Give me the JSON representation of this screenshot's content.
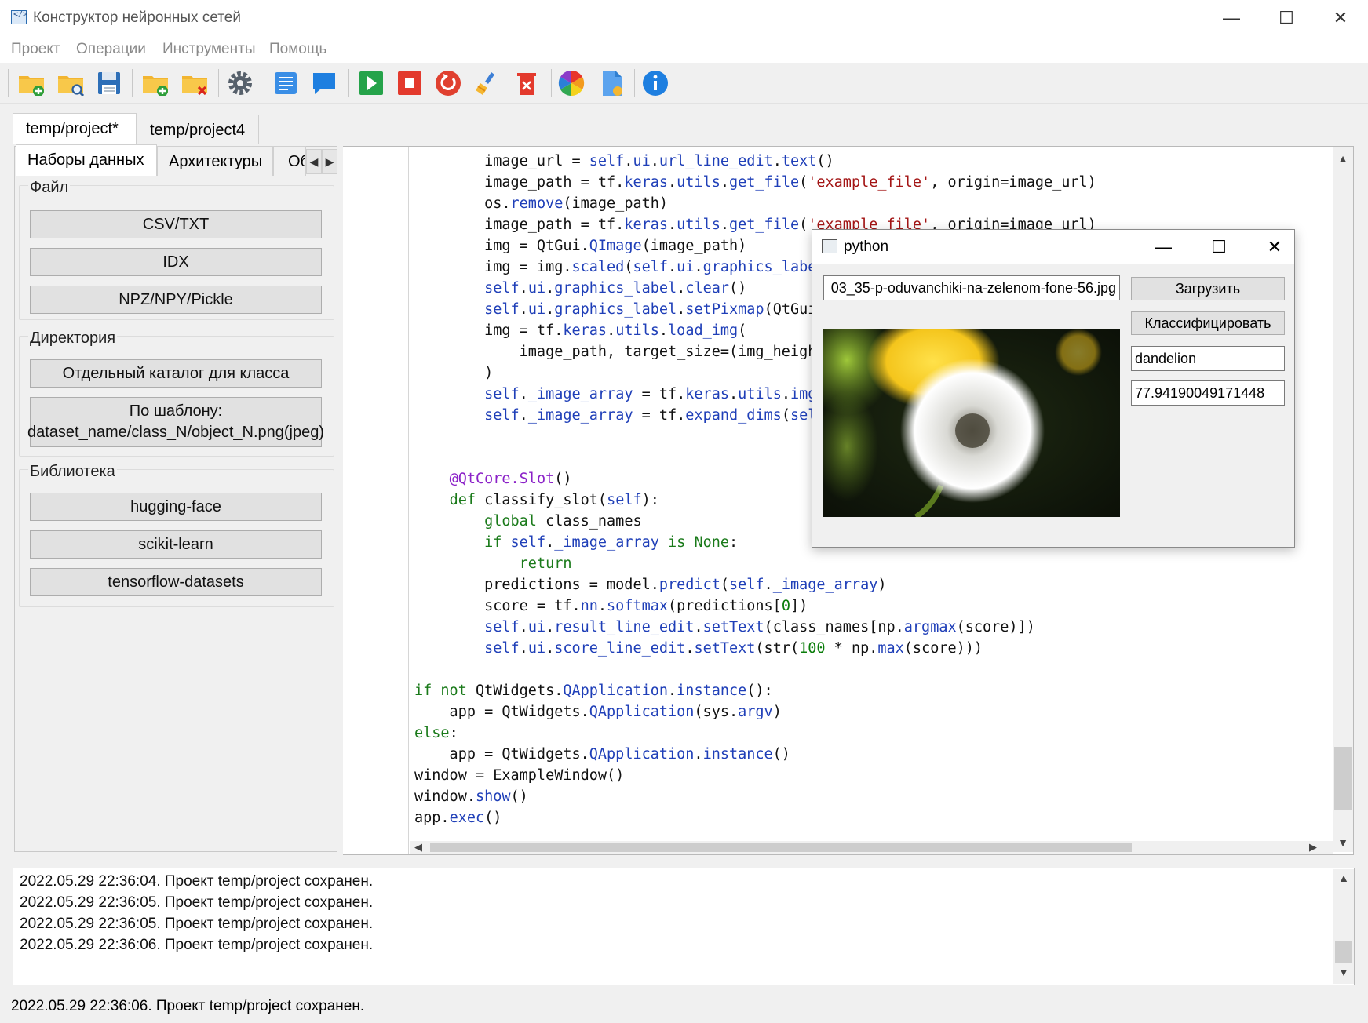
{
  "window": {
    "title": "Конструктор нейронных сетей",
    "minimize": "—",
    "maximize": "☐",
    "close": "✕"
  },
  "menu": [
    "Проект",
    "Операции",
    "Инструменты",
    "Помощь"
  ],
  "toolbar_icons": [
    "new-project-icon",
    "open-project-icon",
    "save-icon",
    "add-folder-icon",
    "remove-folder-icon",
    "settings-icon",
    "text-document-icon",
    "comment-icon",
    "run-icon",
    "stop-icon",
    "restart-icon",
    "clean-icon",
    "delete-icon",
    "color-palette-icon",
    "file-config-icon",
    "info-icon"
  ],
  "project_tabs": [
    "temp/project*",
    "temp/project4"
  ],
  "left_tabs": [
    "Наборы данных",
    "Архитектуры",
    "Об"
  ],
  "left_scroll": {
    "left": "◀",
    "right": "▶"
  },
  "sections": {
    "file": {
      "label": "Файл",
      "buttons": [
        "CSV/TXT",
        "IDX",
        "NPZ/NPY/Pickle"
      ]
    },
    "directory": {
      "label": "Директория",
      "buttons": [
        "Отдельный каталог для класса"
      ],
      "template_button": {
        "line1": "По шаблону:",
        "line2": "dataset_name/class_N/object_N.png(jpeg)"
      }
    },
    "library": {
      "label": "Библиотека",
      "buttons": [
        "hugging-face",
        "scikit-learn",
        "tensorflow-datasets"
      ]
    }
  },
  "code_lines": [
    "        image_url = self.ui.url_line_edit.text()",
    "        image_path = tf.keras.utils.get_file('example_file', origin=image_url)",
    "        os.remove(image_path)",
    "        image_path = tf.keras.utils.get_file('example_file', origin=image_url)",
    "        img = QtGui.QImage(image_path)",
    "        img = img.scaled(self.ui.graphics_label.width(), self.ui.graphics_label.height(), aspe",
    "        self.ui.graphics_label.clear()",
    "        self.ui.graphics_label.setPixmap(QtGui.QPixmap.fromImage(img))",
    "        img = tf.keras.utils.load_img(",
    "            image_path, target_size=(img_height, img_width)",
    "        )",
    "        self._image_array = tf.keras.utils.img_to_array(img)",
    "        self._image_array = tf.expand_dims(self._image_array, 0)",
    "",
    "",
    "    @QtCore.Slot()",
    "    def classify_slot(self):",
    "        global class_names",
    "        if self._image_array is None:",
    "            return",
    "        predictions = model.predict(self._image_array)",
    "        score = tf.nn.softmax(predictions[0])",
    "        self.ui.result_line_edit.setText(class_names[np.argmax(score)])",
    "        self.ui.score_line_edit.setText(str(100 * np.max(score)))",
    "",
    "if not QtWidgets.QApplication.instance():",
    "    app = QtWidgets.QApplication(sys.argv)",
    "else:",
    "    app = QtWidgets.QApplication.instance()",
    "window = ExampleWindow()",
    "window.show()",
    "app.exec()"
  ],
  "log_lines": [
    "2022.05.29 22:36:04. Проект temp/project сохранен.",
    "2022.05.29 22:36:05. Проект temp/project сохранен.",
    "2022.05.29 22:36:05. Проект temp/project сохранен.",
    "2022.05.29 22:36:06. Проект temp/project сохранен."
  ],
  "status_text": "2022.05.29 22:36:06. Проект temp/project сохранен.",
  "dialog": {
    "title": "python",
    "url_value": "03_35-p-oduvanchiki-na-zelenom-fone-56.jpg",
    "load_button": "Загрузить",
    "classify_button": "Классифицировать",
    "result_value": "dandelion",
    "score_value": "77.94190049171448",
    "image_icon": "dandelion-photo"
  }
}
